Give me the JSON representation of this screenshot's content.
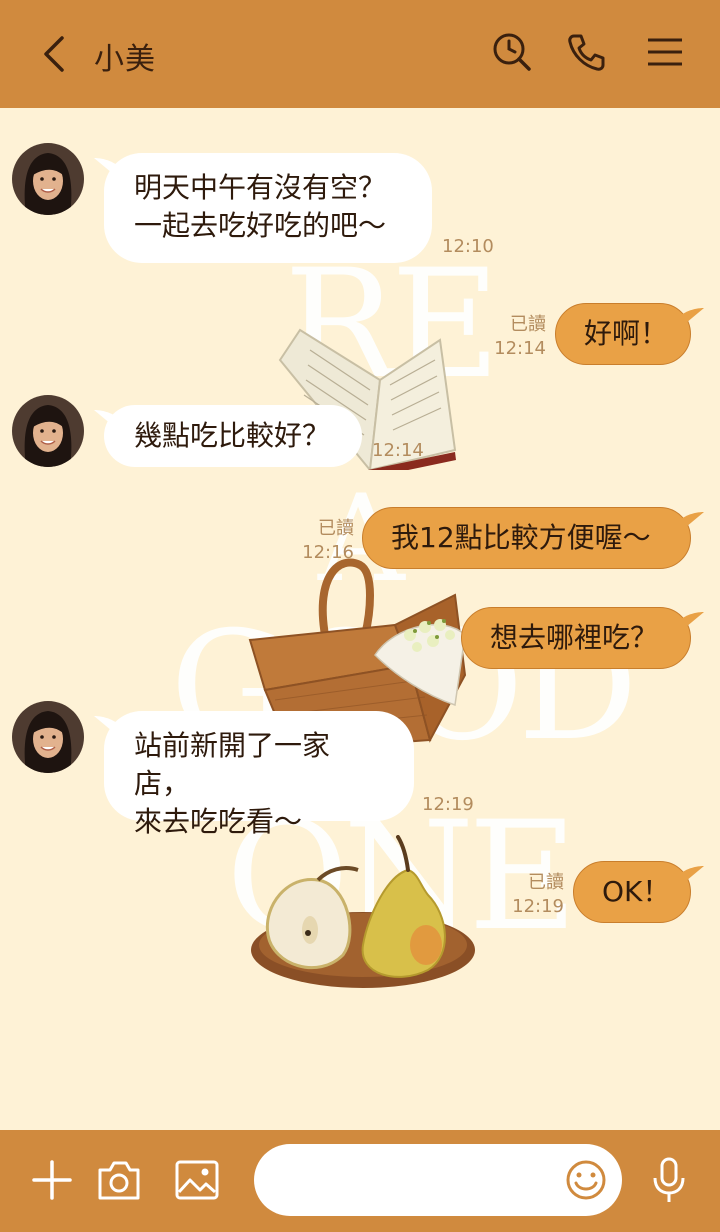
{
  "header": {
    "title": "小美"
  },
  "background": {
    "words": [
      "RE",
      "A",
      "GOOD",
      "ONE"
    ]
  },
  "messages": [
    {
      "side": "left",
      "text": "明天中午有沒有空？\n一起去吃好吃的吧～",
      "time": "12:10"
    },
    {
      "side": "right",
      "text": "好啊！",
      "read": "已讀",
      "time": "12:14"
    },
    {
      "side": "left",
      "text": "幾點吃比較好？",
      "time": "12:14"
    },
    {
      "side": "right",
      "text": "我12點比較方便喔～",
      "read": "已讀",
      "time": "12:16"
    },
    {
      "side": "right",
      "text": "想去哪裡吃？"
    },
    {
      "side": "left",
      "text": "站前新開了一家店，\n來去吃吃看～",
      "time": "12:19"
    },
    {
      "side": "right",
      "text": "OK！",
      "read": "已讀",
      "time": "12:19"
    }
  ],
  "footer": {
    "input_value": ""
  },
  "colors": {
    "header": "#D08A3E",
    "background": "#FEF2D6",
    "own_bubble": "#E9A146",
    "other_bubble": "#FFFFFF",
    "timestamp": "#B38C5E"
  }
}
